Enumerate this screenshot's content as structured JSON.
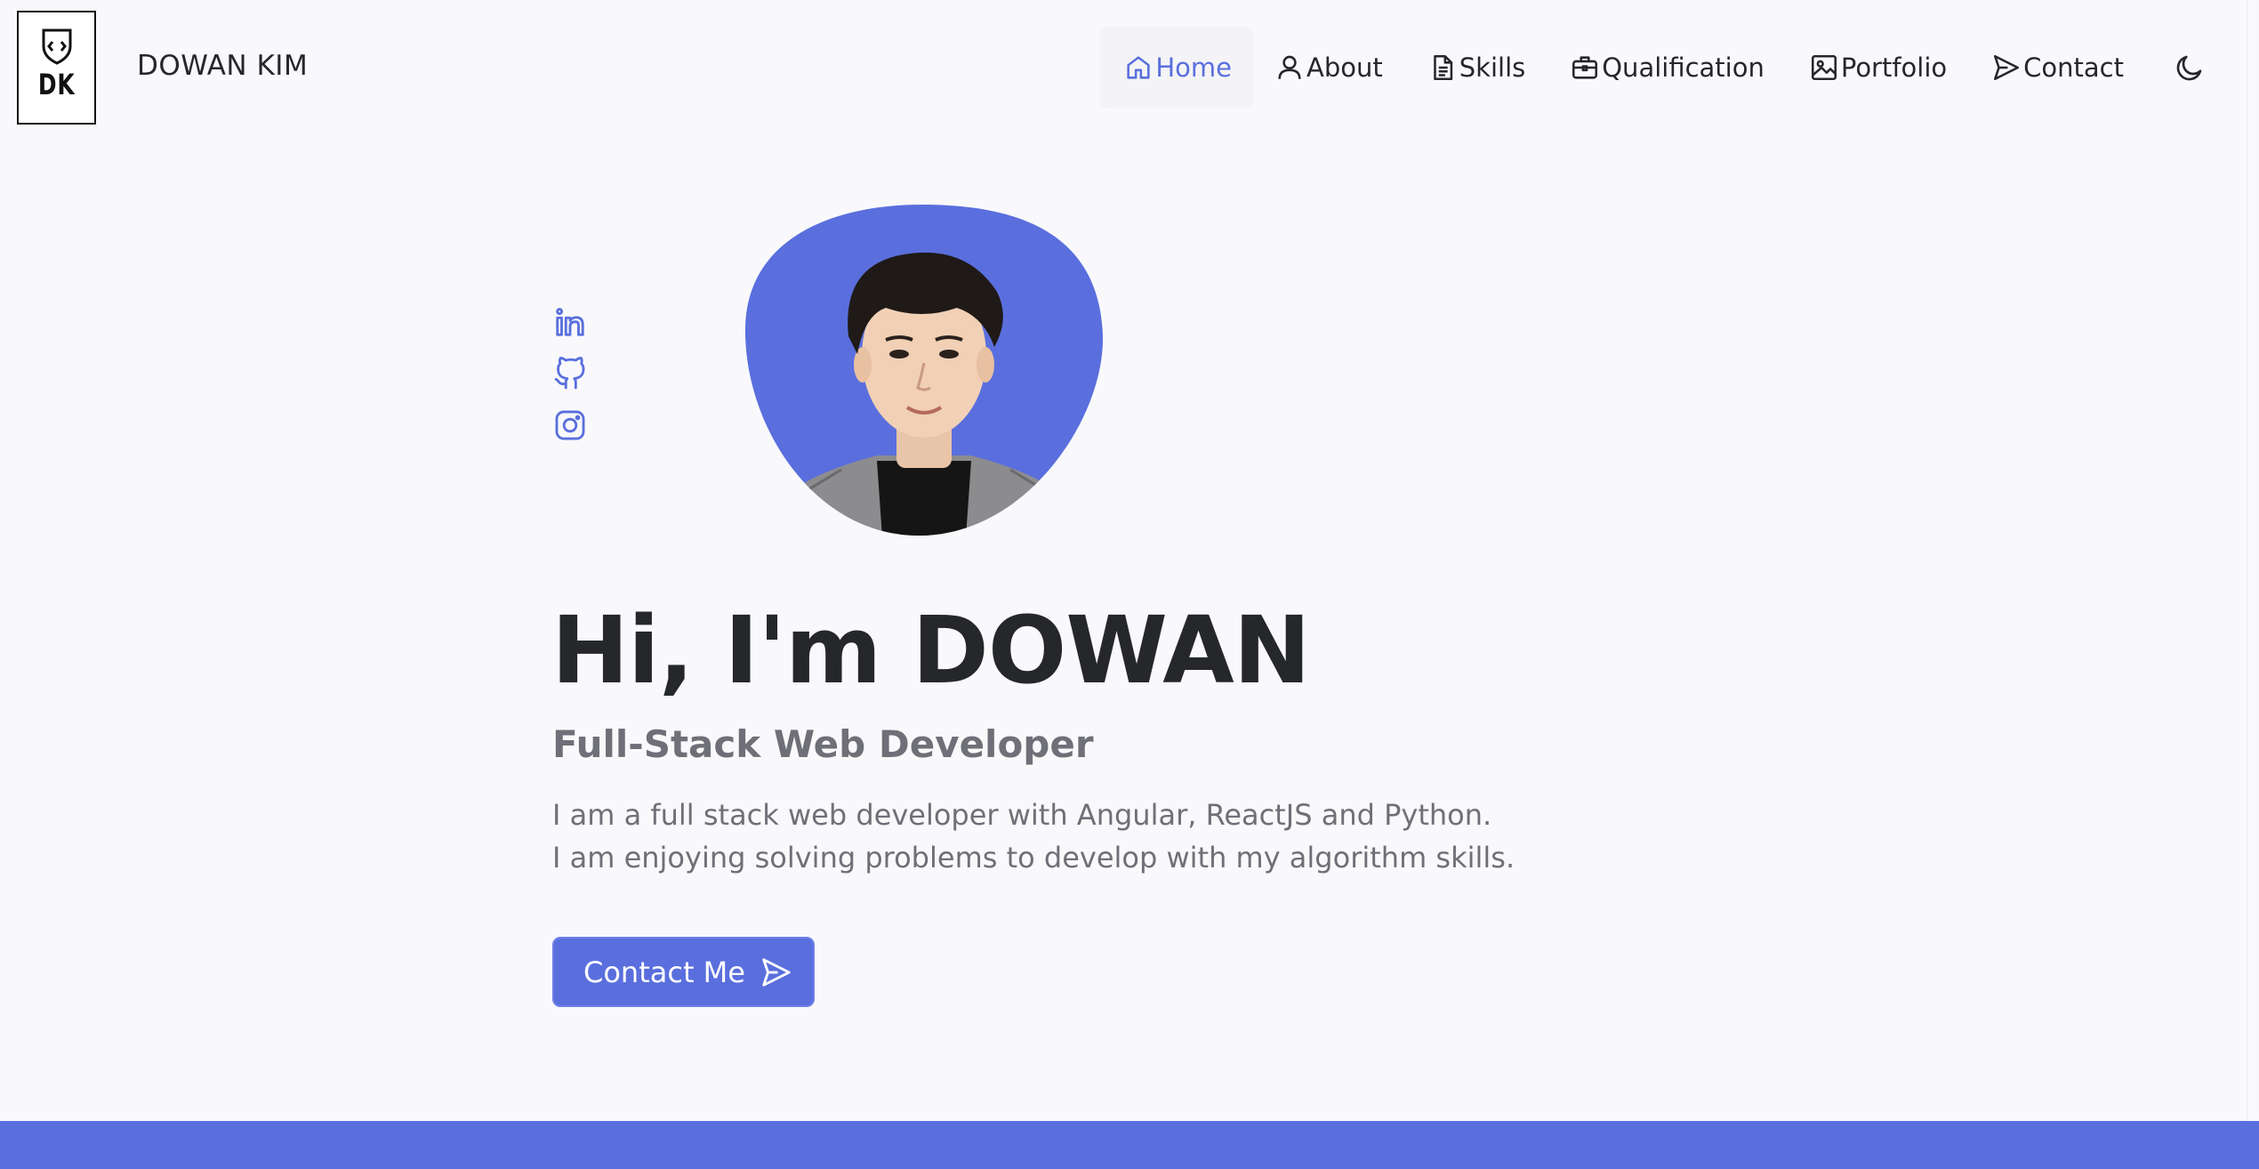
{
  "brand": {
    "logo_text": "DK",
    "name": "DOWAN KIM"
  },
  "nav": {
    "items": [
      {
        "label": "Home",
        "icon": "home-icon",
        "active": true
      },
      {
        "label": "About",
        "icon": "user-icon"
      },
      {
        "label": "Skills",
        "icon": "file-icon"
      },
      {
        "label": "Qualification",
        "icon": "briefcase-icon"
      },
      {
        "label": "Portfolio",
        "icon": "image-icon"
      },
      {
        "label": "Contact",
        "icon": "send-icon"
      }
    ],
    "theme_toggle_icon": "moon-icon"
  },
  "socials": [
    {
      "icon": "linkedin-icon"
    },
    {
      "icon": "github-icon"
    },
    {
      "icon": "instagram-icon"
    }
  ],
  "hero": {
    "title": "Hi, I'm DOWAN",
    "subtitle": "Full-Stack Web Developer",
    "description_line1": "I am a full stack web developer with Angular, ReactJS and Python.",
    "description_line2": "I am enjoying solving problems to develop with my algorithm skills.",
    "cta_label": "Contact Me",
    "cta_icon": "send-icon"
  },
  "colors": {
    "accent": "#5a6fdd",
    "background": "#f9f9fc",
    "text": "#26272b",
    "muted_text": "#6f7077"
  }
}
